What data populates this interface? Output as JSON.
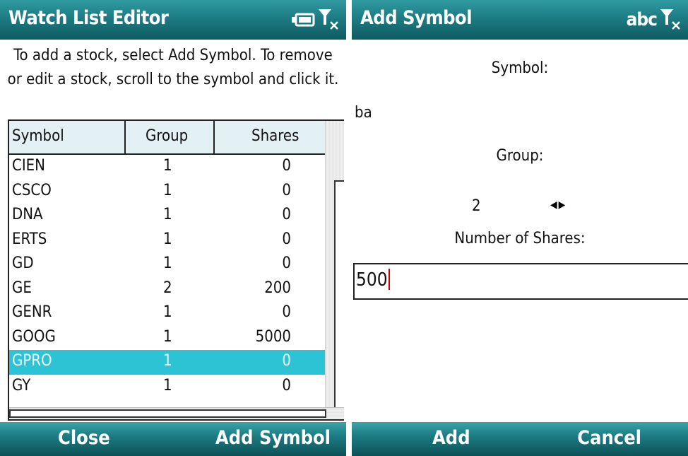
{
  "left_screen": {
    "title": "Watch List Editor",
    "instructions": "To add a stock, select Add Symbol.  To remove or edit a stock, scroll to the symbol and click it.",
    "columns": [
      "Symbol",
      "Group",
      "Shares"
    ],
    "rows": [
      {
        "symbol": "CIEN",
        "group": "1",
        "shares": "0"
      },
      {
        "symbol": "CSCO",
        "group": "1",
        "shares": "0"
      },
      {
        "symbol": "DNA",
        "group": "1",
        "shares": "0"
      },
      {
        "symbol": "ERTS",
        "group": "1",
        "shares": "0"
      },
      {
        "symbol": "GD",
        "group": "1",
        "shares": "0"
      },
      {
        "symbol": "GE",
        "group": "2",
        "shares": "200"
      },
      {
        "symbol": "GENR",
        "group": "1",
        "shares": "0"
      },
      {
        "symbol": "GOOG",
        "group": "1",
        "shares": "5000"
      },
      {
        "symbol": "GPRO",
        "group": "1",
        "shares": "0"
      },
      {
        "symbol": "GY",
        "group": "1",
        "shares": "0"
      }
    ],
    "selected_row_index": 8,
    "softkeys": {
      "left": "Close",
      "right": "Add Symbol"
    },
    "status_icons": [
      "battery-icon",
      "signal-off-icon"
    ]
  },
  "right_screen": {
    "title": "Add Symbol",
    "input_mode": "abc",
    "symbol_label": "Symbol:",
    "symbol_value": "ba",
    "group_label": "Group:",
    "group_value": "2",
    "shares_label": "Number of Shares:",
    "shares_value": "500",
    "softkeys": {
      "left": "Add",
      "right": "Cancel"
    },
    "status_icons": [
      "signal-off-icon"
    ]
  },
  "colors": {
    "titlebar": "#1d7c83",
    "selection": "#2cc3d4",
    "header_bg": "#e3f0f4",
    "caret": "#cc0000"
  }
}
